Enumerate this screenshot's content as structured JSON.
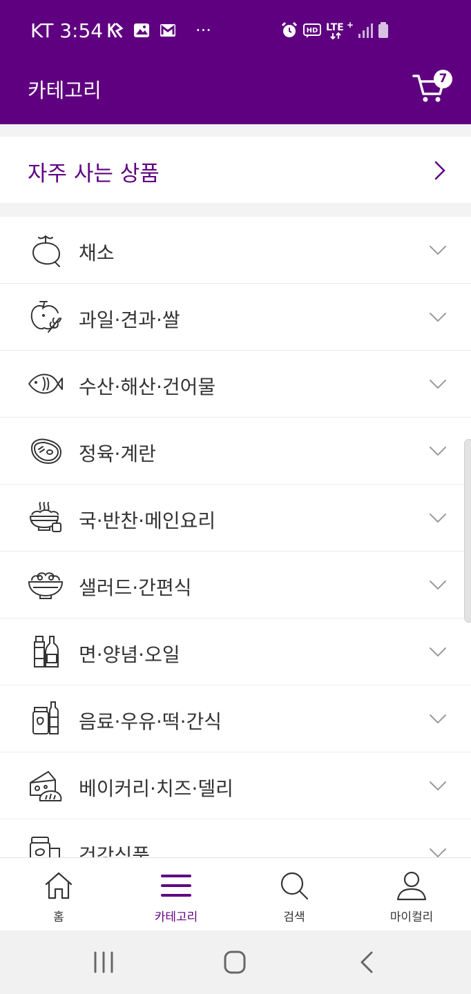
{
  "status_bar": {
    "carrier_time": "KT 3:54",
    "overflow": "···",
    "icons_left": [
      "kakaotalk-icon",
      "gallery-icon",
      "gmail-icon"
    ],
    "icons_right": [
      "alarm-icon",
      "hd-voice-icon",
      "lte-plus-icon",
      "signal-icon",
      "battery-icon"
    ]
  },
  "header": {
    "title": "카테고리",
    "cart_count": "7",
    "background": "#5f0080"
  },
  "frequent": {
    "label": "자주 사는 상품"
  },
  "categories": [
    {
      "label": "채소",
      "icon": "beet-icon"
    },
    {
      "label": "과일·견과·쌀",
      "icon": "apple-icon"
    },
    {
      "label": "수산·해산·건어물",
      "icon": "fish-icon"
    },
    {
      "label": "정육·계란",
      "icon": "steak-icon"
    },
    {
      "label": "국·반찬·메인요리",
      "icon": "soup-bowl-icon"
    },
    {
      "label": "샐러드·간편식",
      "icon": "salad-icon"
    },
    {
      "label": "면·양념·오일",
      "icon": "bottles-icon"
    },
    {
      "label": "음료·우유·떡·간식",
      "icon": "jar-bottle-icon"
    },
    {
      "label": "베이커리·치즈·델리",
      "icon": "cheese-bread-icon"
    },
    {
      "label": "건강식품",
      "icon": "supplement-icon"
    }
  ],
  "tabs": [
    {
      "label": "홈",
      "icon": "home-icon",
      "active": false
    },
    {
      "label": "카테고리",
      "icon": "menu-icon",
      "active": true
    },
    {
      "label": "검색",
      "icon": "search-icon",
      "active": false
    },
    {
      "label": "마이컬리",
      "icon": "user-icon",
      "active": false
    }
  ],
  "colors": {
    "accent": "#5f0080",
    "text": "#333333",
    "divider": "#ececec"
  }
}
